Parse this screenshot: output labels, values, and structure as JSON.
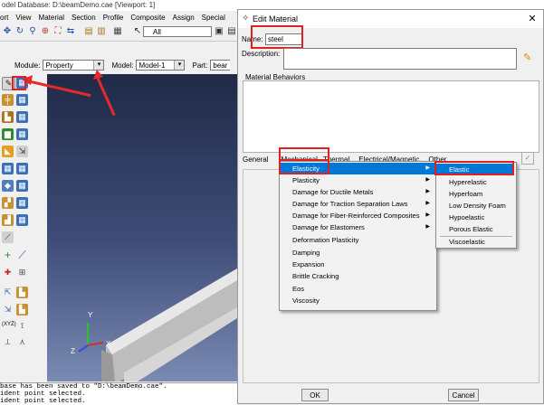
{
  "app": {
    "title": "odel Database: D:\\beamDemo.cae [Viewport: 1]"
  },
  "menubar": [
    "ort",
    "View",
    "Material",
    "Section",
    "Profile",
    "Composite",
    "Assign",
    "Special"
  ],
  "toolbar": {
    "select_value": "All"
  },
  "modulebar": {
    "module_label": "Module:",
    "module_value": "Property",
    "model_label": "Model:",
    "model_value": "Model-1",
    "part_label": "Part:",
    "part_value": "bear"
  },
  "viewport": {
    "axis_x": "X",
    "axis_y": "Y",
    "axis_z": "Z"
  },
  "toolbox": {
    "xyz_label": "(XYZ)"
  },
  "messages": [
    "base has been saved to \"D:\\beamDemo.cae\".",
    "ident point selected.",
    "ident point selected."
  ],
  "dialog": {
    "title": "Edit Material",
    "name_label": "Name:",
    "name_value": "steel",
    "description_label": "Description:",
    "behaviors_label": "Material Behaviors",
    "tabs": [
      "General",
      "Mechanical",
      "Thermal",
      "Electrical/Magnetic",
      "Other"
    ],
    "ok_label": "OK",
    "cancel_label": "Cancel"
  },
  "mechanical_menu": [
    {
      "label": "Elasticity",
      "has_sub": true
    },
    {
      "label": "Plasticity",
      "has_sub": true
    },
    {
      "label": "Damage for Ductile Metals",
      "has_sub": true
    },
    {
      "label": "Damage for Traction Separation Laws",
      "has_sub": true
    },
    {
      "label": "Damage for Fiber-Reinforced Composites",
      "has_sub": true
    },
    {
      "label": "Damage for Elastomers",
      "has_sub": true
    },
    {
      "label": "Deformation Plasticity",
      "has_sub": false
    },
    {
      "label": "Damping",
      "has_sub": false
    },
    {
      "label": "Expansion",
      "has_sub": false
    },
    {
      "label": "Brittle Cracking",
      "has_sub": false
    },
    {
      "label": "Eos",
      "has_sub": false
    },
    {
      "label": "Viscosity",
      "has_sub": false
    }
  ],
  "elasticity_menu": [
    "Elastic",
    "Hyperelastic",
    "Hyperfoam",
    "Low Density Foam",
    "Hypoelastic",
    "Porous Elastic",
    "Viscoelastic"
  ],
  "colors": {
    "highlight": "#0078d7",
    "annotation_red": "#e02020"
  }
}
